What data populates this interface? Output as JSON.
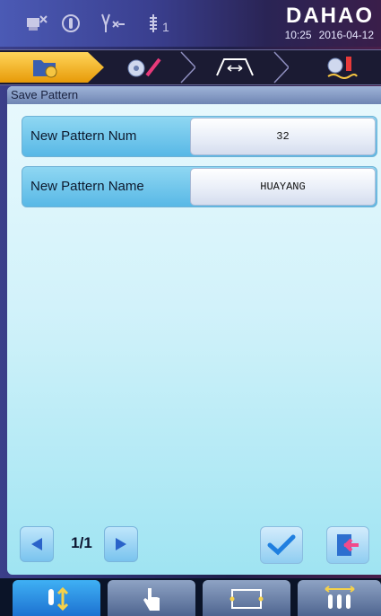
{
  "status": {
    "brand": "DAHAO",
    "time": "10:25",
    "date": "2016-04-12",
    "icons": [
      "machine-status-icon",
      "needle-position-icon",
      "thread-break-icon",
      "needle-bar-icon"
    ],
    "needle_subscript": "1"
  },
  "steps": {
    "items": [
      {
        "name": "pattern-folder",
        "icon": "folder-flower-icon",
        "active": true
      },
      {
        "name": "pattern-edit",
        "icon": "flower-pencil-icon",
        "active": false
      },
      {
        "name": "frame-settings",
        "icon": "frame-span-icon",
        "active": false
      },
      {
        "name": "embroider",
        "icon": "flower-embroider-icon",
        "active": false
      }
    ],
    "active_color": "#f5b21a"
  },
  "panel": {
    "title": "Save Pattern",
    "fields": [
      {
        "label": "New Pattern Num",
        "value": "32"
      },
      {
        "label": "New Pattern Name",
        "value": "HUAYANG"
      }
    ]
  },
  "pager": {
    "page": "1/1"
  },
  "bottom_nav": {
    "items": [
      {
        "name": "needle-updown",
        "icon": "needle-updown-icon",
        "active": true
      },
      {
        "name": "manual-touch",
        "icon": "hand-pointer-icon",
        "active": false
      },
      {
        "name": "frame-view",
        "icon": "frame-rect-icon",
        "active": false
      },
      {
        "name": "multi-needle",
        "icon": "multi-needle-icon",
        "active": false
      }
    ]
  }
}
